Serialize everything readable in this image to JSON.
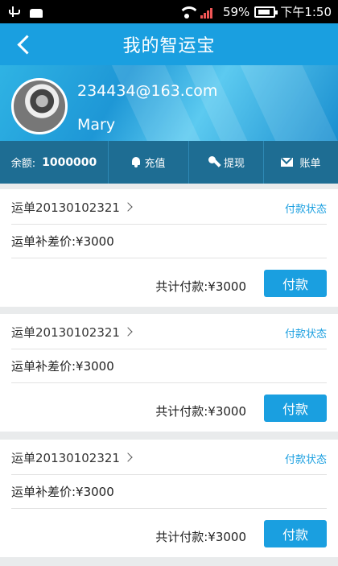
{
  "status_bar": {
    "battery": "59%",
    "time": "下午1:50",
    "icons": [
      "usb-icon",
      "android-icon",
      "wifi-icon",
      "signal-icon",
      "battery-icon"
    ]
  },
  "header": {
    "title": "我的智运宝",
    "back_icon": "chevron-left-icon"
  },
  "profile": {
    "email": "234434@163.com",
    "name": "Mary"
  },
  "actions": {
    "balance_label": "余额:",
    "balance_value": "1000000",
    "recharge_label": "充值",
    "withdraw_label": "提现",
    "bill_label": "账单"
  },
  "orders": [
    {
      "id": "运单20130102321",
      "status": "付款状态",
      "detail": "运单补差价:¥3000",
      "total": "共计付款:¥3000",
      "button": "付款"
    },
    {
      "id": "运单20130102321",
      "status": "付款状态",
      "detail": "运单补差价:¥3000",
      "total": "共计付款:¥3000",
      "button": "付款"
    },
    {
      "id": "运单20130102321",
      "status": "付款状态",
      "detail": "运单补差价:¥3000",
      "total": "共计付款:¥3000",
      "button": "付款"
    }
  ],
  "colors": {
    "primary": "#1a9fe0",
    "action_bar": "#1e6d93",
    "background": "#e9ebec"
  }
}
